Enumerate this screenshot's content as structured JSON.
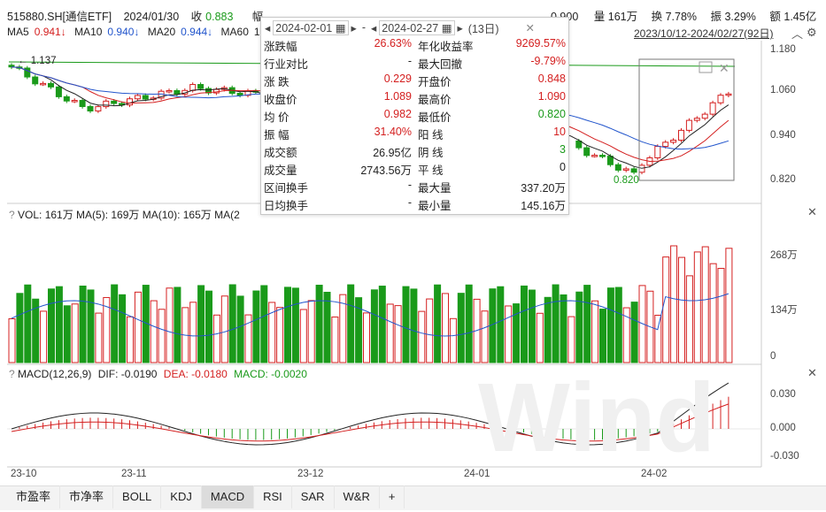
{
  "header": {
    "symbol": "515880.SH[通信ETF]",
    "date": "2024/01/30",
    "close_label": "收",
    "close_value": "0.883",
    "amp_cut": "幅",
    "vol_cut": "0.900",
    "volume": "量 161万",
    "turnover": "换 7.78%",
    "amplitude": "振 3.29%",
    "amount": "额 1.45亿"
  },
  "ma": {
    "ma5_label": "MA5",
    "ma5_value": "0.941↓",
    "ma10_label": "MA10",
    "ma10_value": "0.940↓",
    "ma20_label": "MA20",
    "ma20_value": "0.944↓",
    "ma60_label": "MA60",
    "ma60_value": "1."
  },
  "range": "2023/10/12-2024/02/27(92日)",
  "price_axis": [
    "1.180",
    "1.060",
    "0.940",
    "0.820"
  ],
  "annotations": {
    "high": "1.137",
    "low": "0.820"
  },
  "volume_panel": {
    "label": "VOL: 161万  MA(5): 169万  MA(10): 165万  MA(2",
    "axis": [
      "268万",
      "134万",
      "0"
    ]
  },
  "macd_panel": {
    "label_prefix": "MACD(12,26,9)",
    "dif": "DIF: -0.0190",
    "dea": "DEA: -0.0180",
    "macd": "MACD: -0.0020",
    "axis": [
      "0.030",
      "0.000",
      "-0.030"
    ]
  },
  "x_axis": [
    "23-10",
    "23-11",
    "23-12",
    "24-01",
    "24-02"
  ],
  "tooltip": {
    "start_date": "2024-02-01",
    "end_date": "2024-02-27",
    "days": "(13日)",
    "rows": [
      {
        "l": "涨跌幅",
        "v": "26.63%",
        "l2": "年化收益率",
        "v2": "9269.57%"
      },
      {
        "l": "行业对比",
        "v": "-",
        "l2": "最大回撤",
        "v2": "-9.79%"
      },
      {
        "l": "涨  跌",
        "v": "0.229",
        "l2": "开盘价",
        "v2": "0.848"
      },
      {
        "l": "收盘价",
        "v": "1.089",
        "l2": "最高价",
        "v2": "1.090"
      },
      {
        "l": "均  价",
        "v": "0.982",
        "l2": "最低价",
        "v2": "0.820"
      },
      {
        "l": "振  幅",
        "v": "31.40%",
        "l2": "阳  线",
        "v2": "10"
      },
      {
        "l": "成交额",
        "v": "26.95亿",
        "l2": "阴  线",
        "v2": "3"
      },
      {
        "l": "成交量",
        "v": "2743.56万",
        "l2": "平  线",
        "v2": "0"
      },
      {
        "l": "区间换手",
        "v": "-",
        "l2": "最大量",
        "v2": "337.20万"
      },
      {
        "l": "日均换手",
        "v": "-",
        "l2": "最小量",
        "v2": "145.16万"
      }
    ]
  },
  "tabs": [
    "市盈率",
    "市净率",
    "BOLL",
    "KDJ",
    "MACD",
    "RSI",
    "SAR",
    "W&R",
    "+"
  ],
  "active_tab": "MACD",
  "colors": {
    "up": "#d42020",
    "down": "#1a9a1a",
    "ma5": "#222222",
    "ma10": "#d42020",
    "ma20": "#2255cc",
    "ma60": "#1a9a1a"
  }
}
